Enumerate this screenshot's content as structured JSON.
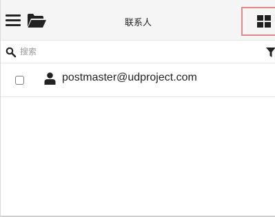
{
  "header": {
    "title": "联系人",
    "menu_icon": "menu-icon",
    "folder_icon": "folder-open-icon",
    "view_icon": "grid-view-icon"
  },
  "search": {
    "placeholder": "搜索",
    "value": "",
    "search_icon": "search-icon",
    "filter_icon": "filter-icon"
  },
  "contacts": [
    {
      "email": "postmaster@udproject.com",
      "checked": false,
      "icon": "user-icon"
    }
  ],
  "colors": {
    "toolbar_bg": "#f5f5f5",
    "highlight_border": "#e0888c",
    "icon": "#222222",
    "text": "#222222",
    "placeholder": "#9a9a9a"
  }
}
